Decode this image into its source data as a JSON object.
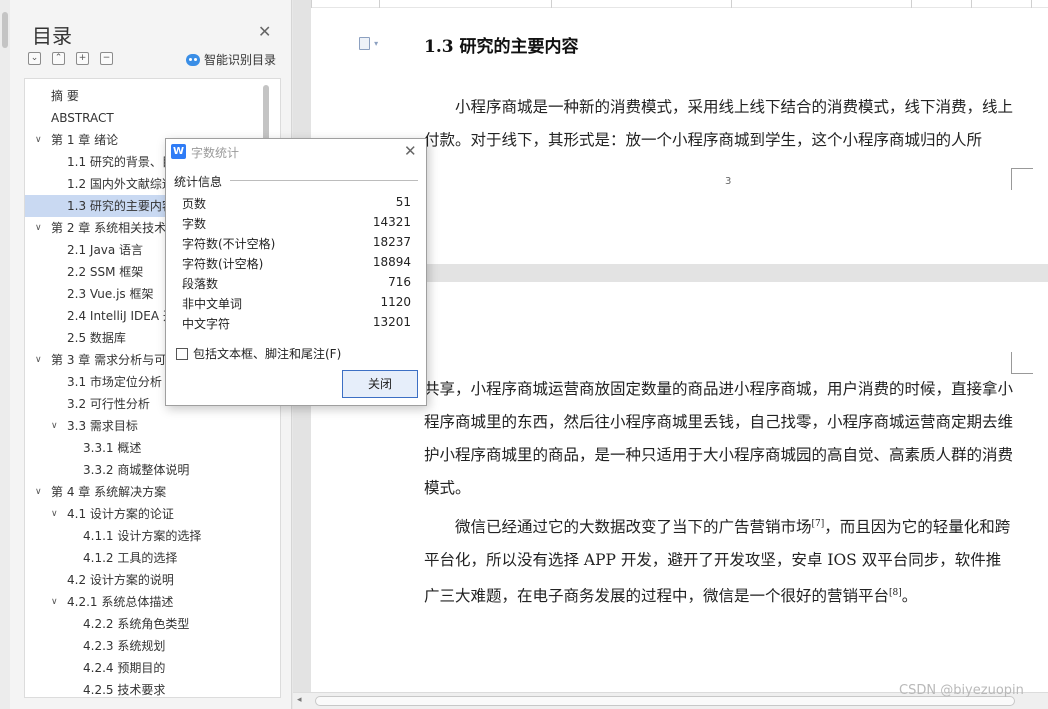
{
  "sidebar": {
    "title": "目录",
    "smart_toc_label": "智能识别目录",
    "toolbar_buttons": [
      "⌄",
      "⌃",
      "+",
      "−"
    ],
    "items": [
      {
        "label": "摘  要",
        "level": 0,
        "arrow": "",
        "selected": false
      },
      {
        "label": "ABSTRACT",
        "level": 0,
        "arrow": "",
        "selected": false
      },
      {
        "label": "第 1 章  绪论",
        "level": 0,
        "arrow": "∨",
        "selected": false
      },
      {
        "label": "1.1  研究的背景、目",
        "level": 1,
        "arrow": "",
        "selected": false
      },
      {
        "label": "1.2  国内外文献综述",
        "level": 1,
        "arrow": "",
        "selected": false
      },
      {
        "label": "1.3  研究的主要内容",
        "level": 1,
        "arrow": "",
        "selected": true
      },
      {
        "label": "第 2 章  系统相关技术",
        "level": 0,
        "arrow": "∨",
        "selected": false
      },
      {
        "label": "2.1 Java 语言",
        "level": 1,
        "arrow": "",
        "selected": false
      },
      {
        "label": "2.2 SSM 框架",
        "level": 1,
        "arrow": "",
        "selected": false
      },
      {
        "label": "2.3 Vue.js 框架",
        "level": 1,
        "arrow": "",
        "selected": false
      },
      {
        "label": "2.4 IntelliJ IDEA 开",
        "level": 1,
        "arrow": "",
        "selected": false
      },
      {
        "label": "2.5  数据库",
        "level": 1,
        "arrow": "",
        "selected": false
      },
      {
        "label": "第 3 章  需求分析与可",
        "level": 0,
        "arrow": "∨",
        "selected": false
      },
      {
        "label": "3.1  市场定位分析",
        "level": 1,
        "arrow": "",
        "selected": false
      },
      {
        "label": "3.2  可行性分析",
        "level": 1,
        "arrow": "",
        "selected": false
      },
      {
        "label": "3.3  需求目标",
        "level": 1,
        "arrow": "∨",
        "selected": false
      },
      {
        "label": "3.3.1  概述",
        "level": 2,
        "arrow": "",
        "selected": false
      },
      {
        "label": "3.3.2  商城整体说明",
        "level": 2,
        "arrow": "",
        "selected": false
      },
      {
        "label": "第 4 章  系统解决方案",
        "level": 0,
        "arrow": "∨",
        "selected": false
      },
      {
        "label": "4.1  设计方案的论证",
        "level": 1,
        "arrow": "∨",
        "selected": false
      },
      {
        "label": "4.1.1  设计方案的选择",
        "level": 2,
        "arrow": "",
        "selected": false
      },
      {
        "label": "4.1.2  工具的选择",
        "level": 2,
        "arrow": "",
        "selected": false
      },
      {
        "label": "4.2  设计方案的说明",
        "level": 1,
        "arrow": "",
        "selected": false
      },
      {
        "label": "4.2.1  系统总体描述",
        "level": 1,
        "arrow": "∨",
        "selected": false
      },
      {
        "label": "4.2.2  系统角色类型",
        "level": 2,
        "arrow": "",
        "selected": false
      },
      {
        "label": "4.2.3  系统规划",
        "level": 2,
        "arrow": "",
        "selected": false
      },
      {
        "label": "4.2.4  预期目的",
        "level": 2,
        "arrow": "",
        "selected": false
      },
      {
        "label": "4.2.5  技术要求",
        "level": 2,
        "arrow": "",
        "selected": false
      }
    ]
  },
  "dialog": {
    "title": "字数统计",
    "section_label": "统计信息",
    "stats": [
      {
        "label": "页数",
        "value": "51"
      },
      {
        "label": "字数",
        "value": "14321"
      },
      {
        "label": "字符数(不计空格)",
        "value": "18237"
      },
      {
        "label": "字符数(计空格)",
        "value": "18894"
      },
      {
        "label": "段落数",
        "value": "716"
      },
      {
        "label": "非中文单词",
        "value": "1120"
      },
      {
        "label": "中文字符",
        "value": "13201"
      }
    ],
    "include_label": "包括文本框、脚注和尾注(F)",
    "include_checked": false,
    "close_label": "关闭"
  },
  "document": {
    "heading": "1.3  研究的主要内容",
    "p1": "　　小程序商城是一种新的消费模式，采用线上线下结合的消费模式，线下消费，线上付款。对于线下，其形式是：放一个小程序商城到学生，这个小程序商城归的人所",
    "page_number": "3",
    "p2": "共享，小程序商城运营商放固定数量的商品进小程序商城，用户消费的时候，直接拿小程序商城里的东西，然后往小程序商城里丢钱，自己找零，小程序商城运营商定期去维护小程序商城里的商品，是一种只适用于大小程序商城园的高自觉、高素质人群的消费模式。",
    "p3_a": "　　微信已经通过它的大数据改变了当下的广告营销市场",
    "p3_ref1": "[7]",
    "p3_b": "，而且因为它的轻量化和跨平台化，所以没有选择 APP 开发，避开了开发攻坚，安卓 IOS 双平台同步，软件推广三大难题，在电子商务发展的过程中，微信是一个很好的营销平台",
    "p3_ref2": "[8]",
    "p3_c": "。"
  },
  "watermark": "CSDN @biyezuopin"
}
